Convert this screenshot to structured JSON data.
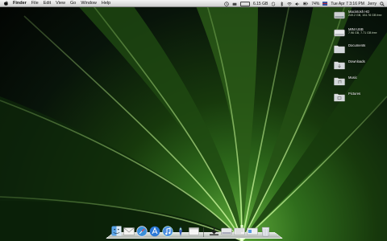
{
  "menubar": {
    "app_name": "Finder",
    "items": [
      "File",
      "Edit",
      "View",
      "Go",
      "Window",
      "Help"
    ],
    "status": {
      "disk_free": "6.15 GB",
      "battery": "74%",
      "datetime": "Tue Apr 7  3:16 PM",
      "user": "Jerry"
    }
  },
  "desktop_icons": [
    {
      "name": "Macintosh HD",
      "detail": "249.2 GB, 104.78 GB free",
      "icon": "hard-drive-icon"
    },
    {
      "name": "MINI USB",
      "detail": "7.96 GB, 7.71 GB free",
      "icon": "usb-drive-icon"
    },
    {
      "name": "Documents",
      "detail": "",
      "icon": "folder-icon"
    },
    {
      "name": "Downloads",
      "detail": "",
      "icon": "folder-icon"
    },
    {
      "name": "Music",
      "detail": "",
      "icon": "folder-icon"
    },
    {
      "name": "Pictures",
      "detail": "",
      "icon": "folder-icon"
    }
  ],
  "dock": {
    "apps": [
      "finder-icon",
      "mail-icon",
      "safari-icon",
      "app-store-icon",
      "itunes-icon",
      "script-icon",
      "finder-window-icon"
    ],
    "stacks": [
      "downloads-stack-icon",
      "drive-stack-icon",
      "documents-stack-icon",
      "applications-stack-icon",
      "trash-icon"
    ]
  }
}
